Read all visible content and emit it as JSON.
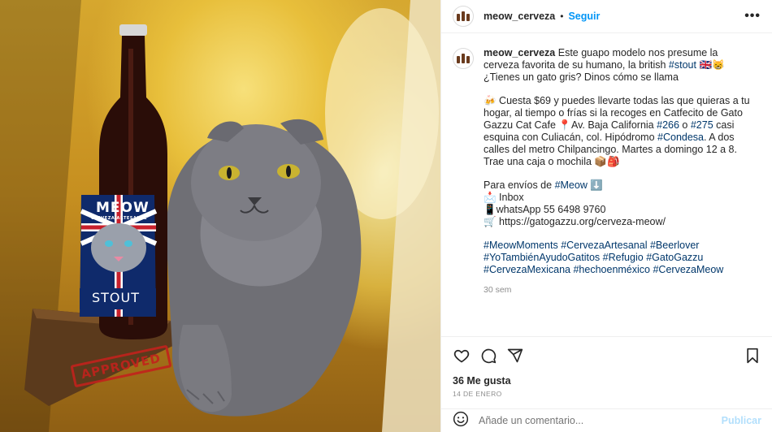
{
  "post": {
    "username": "meow_cerveza",
    "separator": "•",
    "follow_label": "Seguir",
    "more_label": "•••",
    "image_text": {
      "bottle_brand": "MEOW",
      "bottle_sub": "CERVEZA ARTESANAL",
      "bottle_style": "STOUT",
      "stamp": "APPROVED"
    }
  },
  "caption": {
    "username": "meow_cerveza",
    "p1_text_a": " Este guapo modelo nos presume la cerveza favorita de su humano, la british ",
    "p1_tag_stout": "#stout",
    "p1_text_b": " 🇬🇧😸 ¿Tienes un gato gris? Dinos cómo se llama",
    "p2_text_a": "🍻 Cuesta $69 y puedes llevarte todas las que quieras a tu hogar, al tiempo o frías si la recoges en Catfecito de Gato Gazzu Cat Cafe 📍Av. Baja California ",
    "p2_tag_266": "#266",
    "p2_text_b": " o ",
    "p2_tag_275": "#275",
    "p2_text_c": " casi esquina con Culiacán, col. Hipódromo ",
    "p2_tag_condesa": "#Condesa",
    "p2_text_d": ". A dos calles del metro Chilpancingo. Martes a domingo 12 a 8. Trae una caja o mochila 📦🎒",
    "p3_text_a": "Para envíos de ",
    "p3_tag_meow": "#Meow",
    "p3_text_b": " ⬇️",
    "p3_line2": "📩 Inbox",
    "p3_line3": "📱whatsApp 55 6498 9760",
    "p3_line4": "🛒 https://gatogazzu.org/cerveza-meow/",
    "hashtags": [
      "#MeowMoments",
      "#CervezaArtesanal",
      "#Beerlover",
      "#YoTambiénAyudoGatitos",
      "#Refugio",
      "#GatoGazzu",
      "#CervezaMexicana",
      "#hechoenméxico",
      "#CervezaMeow"
    ],
    "time": "30 sem"
  },
  "actions": {
    "like_icon": "heart-icon",
    "comment_icon": "comment-icon",
    "share_icon": "send-icon",
    "save_icon": "bookmark-icon",
    "likes": "36 Me gusta",
    "date": "14 DE ENERO"
  },
  "comment": {
    "emoji_icon": "smiley-icon",
    "placeholder": "Añade un comentario...",
    "publish_label": "Publicar"
  },
  "colors": {
    "link_blue": "#0095f6",
    "hashtag": "#00376b",
    "muted": "#8e8e8e",
    "publish_disabled": "#b2dffc",
    "stamp_red": "#c2221c"
  }
}
